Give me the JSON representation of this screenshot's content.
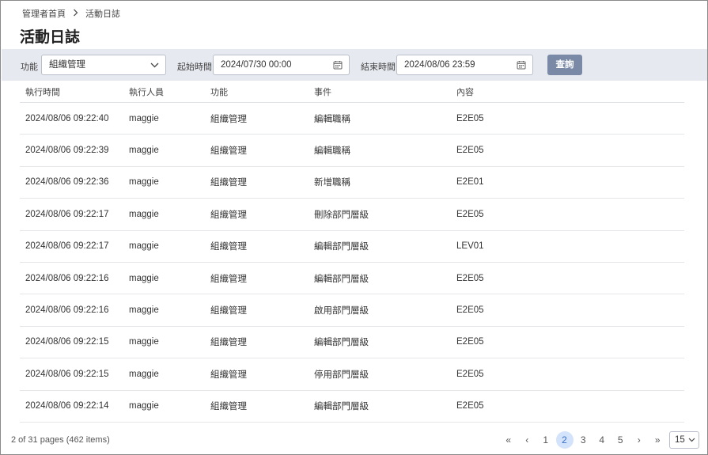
{
  "breadcrumb": {
    "home": "管理者首頁",
    "current": "活動日誌"
  },
  "page_title": "活動日誌",
  "filters": {
    "function_label": "功能",
    "function_value": "組織管理",
    "start_label": "起始時間",
    "start_value": "2024/07/30 00:00",
    "end_label": "結束時間",
    "end_value": "2024/08/06 23:59",
    "query_button": "查詢"
  },
  "table": {
    "columns": [
      "執行時間",
      "執行人員",
      "功能",
      "事件",
      "內容"
    ],
    "rows": [
      [
        "2024/08/06 09:22:40",
        "maggie",
        "組織管理",
        "編輯職稱",
        "E2E05"
      ],
      [
        "2024/08/06 09:22:39",
        "maggie",
        "組織管理",
        "編輯職稱",
        "E2E05"
      ],
      [
        "2024/08/06 09:22:36",
        "maggie",
        "組織管理",
        "新增職稱",
        "E2E01"
      ],
      [
        "2024/08/06 09:22:17",
        "maggie",
        "組織管理",
        "刪除部門層級",
        "E2E05"
      ],
      [
        "2024/08/06 09:22:17",
        "maggie",
        "組織管理",
        "編輯部門層級",
        "LEV01"
      ],
      [
        "2024/08/06 09:22:16",
        "maggie",
        "組織管理",
        "編輯部門層級",
        "E2E05"
      ],
      [
        "2024/08/06 09:22:16",
        "maggie",
        "組織管理",
        "啟用部門層級",
        "E2E05"
      ],
      [
        "2024/08/06 09:22:15",
        "maggie",
        "組織管理",
        "編輯部門層級",
        "E2E05"
      ],
      [
        "2024/08/06 09:22:15",
        "maggie",
        "組織管理",
        "停用部門層級",
        "E2E05"
      ],
      [
        "2024/08/06 09:22:14",
        "maggie",
        "組織管理",
        "編輯部門層級",
        "E2E05"
      ]
    ]
  },
  "pagination": {
    "summary": "2 of 31 pages (462 items)",
    "first": "«",
    "prev": "‹",
    "pages": [
      "1",
      "2",
      "3",
      "4",
      "5"
    ],
    "current_page": "2",
    "next": "›",
    "last": "»",
    "page_size": "15"
  },
  "icons": {
    "chevron": "chevron-down-icon",
    "calendar": "calendar-icon"
  },
  "colors": {
    "filter_bar": "#e6e9ef",
    "query_button": "#7a8aa6",
    "active_page": "#d3e3fb"
  }
}
